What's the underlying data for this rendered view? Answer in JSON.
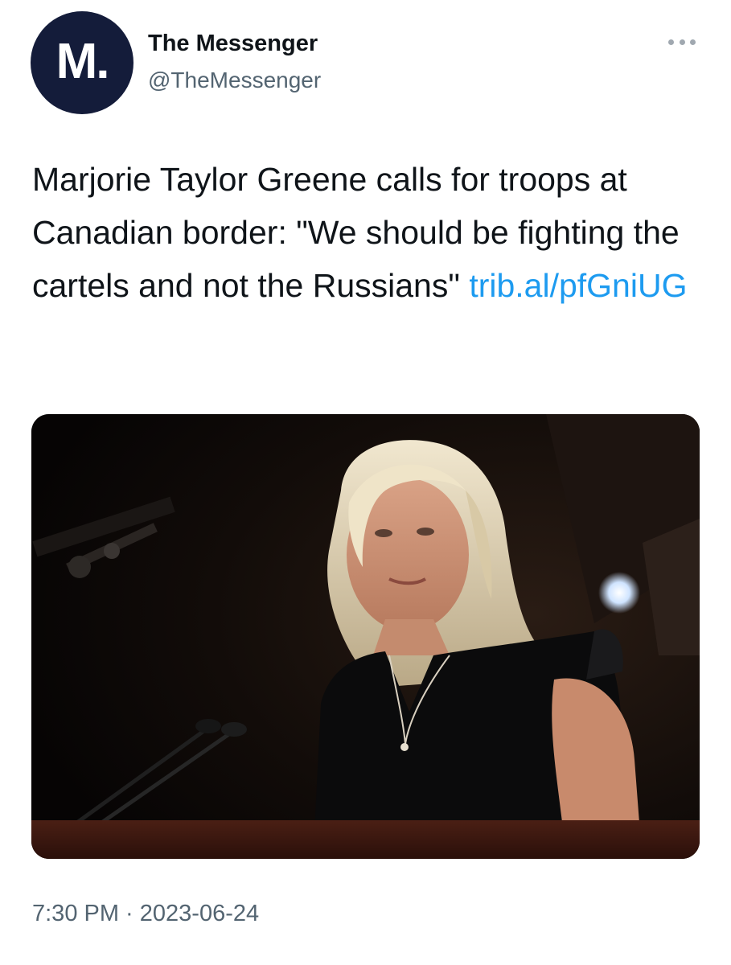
{
  "account": {
    "avatar_text": "M.",
    "display_name": "The Messenger",
    "handle": "@TheMessenger"
  },
  "tweet": {
    "text": "Marjorie Taylor Greene calls for troops at Canadian border: \"We should be fighting the cartels and not the Russians\"",
    "link_text": "trib.al/pfGniUG",
    "timestamp": "7:30 PM · 2023-06-24"
  },
  "icons": {
    "more": "more-horizontal-icon"
  },
  "colors": {
    "avatar_bg": "#141c3a",
    "link": "#1d9bf0",
    "secondary_text": "#536471"
  }
}
